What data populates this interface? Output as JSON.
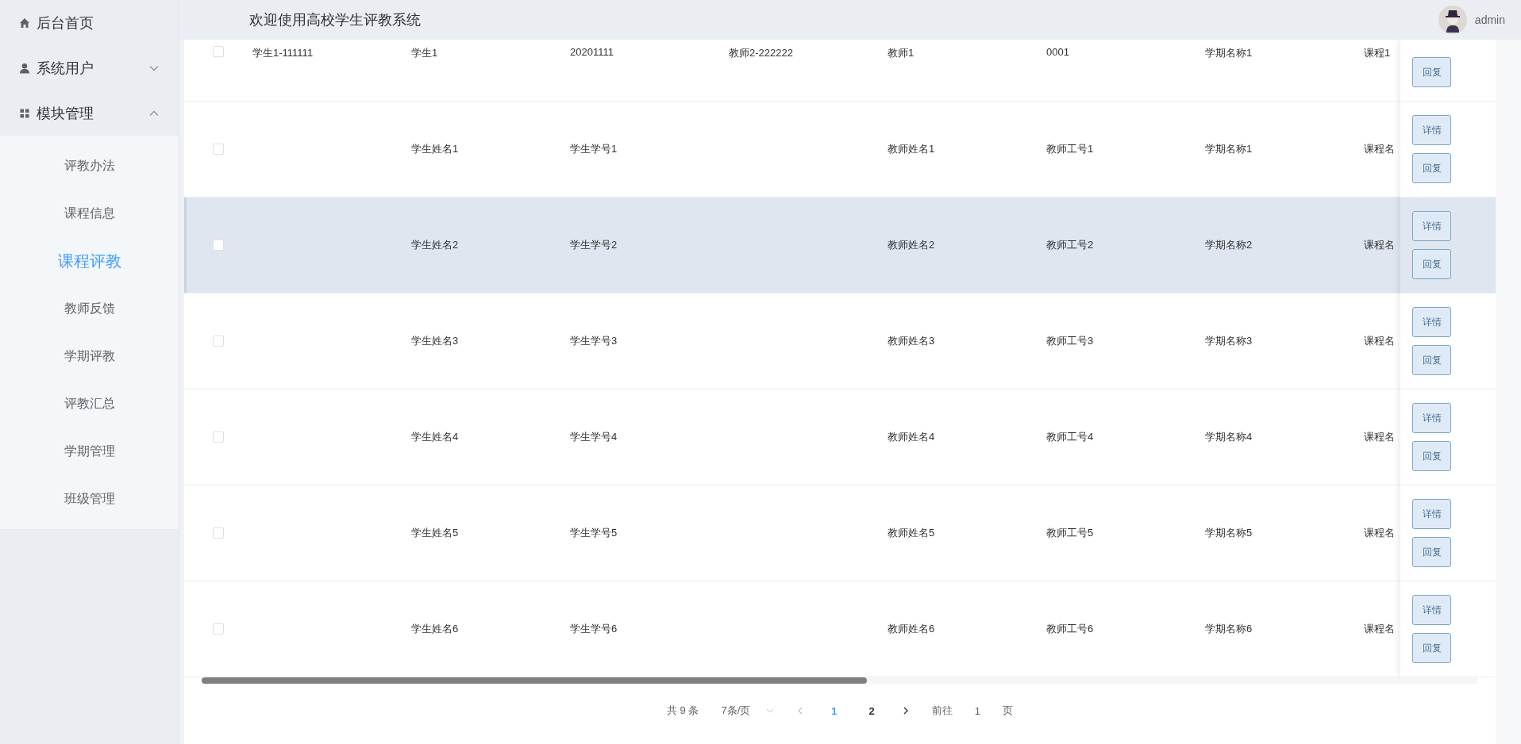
{
  "sidebar": {
    "items": [
      {
        "label": "后台首页"
      },
      {
        "label": "系统用户",
        "expanded": false
      },
      {
        "label": "模块管理",
        "expanded": true,
        "children": [
          {
            "label": "评教办法",
            "selected": false
          },
          {
            "label": "课程信息",
            "selected": false
          },
          {
            "label": "课程评教",
            "selected": true
          },
          {
            "label": "教师反馈",
            "selected": false
          },
          {
            "label": "学期评教",
            "selected": false
          },
          {
            "label": "评教汇总",
            "selected": false
          },
          {
            "label": "学期管理",
            "selected": false
          },
          {
            "label": "班级管理",
            "selected": false
          }
        ]
      }
    ]
  },
  "header": {
    "title": "欢迎使用高校学生评教系统",
    "user": "admin"
  },
  "table": {
    "rows": [
      {
        "checked": false,
        "highlighted": false,
        "column_1": "学生1-111111",
        "column_2": "学生1",
        "column_3": "20201111",
        "column_4": "教师2-222222",
        "column_5": "教师1",
        "column_6": "0001",
        "column_7": "学期名称1",
        "column_8": "课程1",
        "actions": [
          "回复"
        ]
      },
      {
        "checked": false,
        "highlighted": false,
        "column_2": "学生姓名1",
        "column_3": "学生学号1",
        "column_5": "教师姓名1",
        "column_6": "教师工号1",
        "column_7": "学期名称1",
        "column_8": "课程名",
        "actions": [
          "详情",
          "回复"
        ]
      },
      {
        "checked": false,
        "highlighted": true,
        "column_2": "学生姓名2",
        "column_3": "学生学号2",
        "column_5": "教师姓名2",
        "column_6": "教师工号2",
        "column_7": "学期名称2",
        "column_8": "课程名",
        "actions": [
          "详情",
          "回复"
        ]
      },
      {
        "checked": false,
        "highlighted": false,
        "column_2": "学生姓名3",
        "column_3": "学生学号3",
        "column_5": "教师姓名3",
        "column_6": "教师工号3",
        "column_7": "学期名称3",
        "column_8": "课程名",
        "actions": [
          "详情",
          "回复"
        ]
      },
      {
        "checked": false,
        "highlighted": false,
        "column_2": "学生姓名4",
        "column_3": "学生学号4",
        "column_5": "教师姓名4",
        "column_6": "教师工号4",
        "column_7": "学期名称4",
        "column_8": "课程名",
        "actions": [
          "详情",
          "回复"
        ]
      },
      {
        "checked": false,
        "highlighted": false,
        "column_2": "学生姓名5",
        "column_3": "学生学号5",
        "column_5": "教师姓名5",
        "column_6": "教师工号5",
        "column_7": "学期名称5",
        "column_8": "课程名",
        "actions": [
          "详情",
          "回复"
        ]
      },
      {
        "checked": false,
        "highlighted": false,
        "column_2": "学生姓名6",
        "column_3": "学生学号6",
        "column_5": "教师姓名6",
        "column_6": "教师工号6",
        "column_7": "学期名称6",
        "column_8": "课程名",
        "actions": [
          "详情",
          "回复"
        ]
      }
    ]
  },
  "pagination": {
    "total": "共 9 条",
    "page_size": "7条/页",
    "pages": [
      {
        "label": "1",
        "selected": true
      },
      {
        "label": "2",
        "selected": false
      }
    ],
    "goto_label": "前往",
    "goto_value": "1",
    "goto_suffix": "页"
  }
}
